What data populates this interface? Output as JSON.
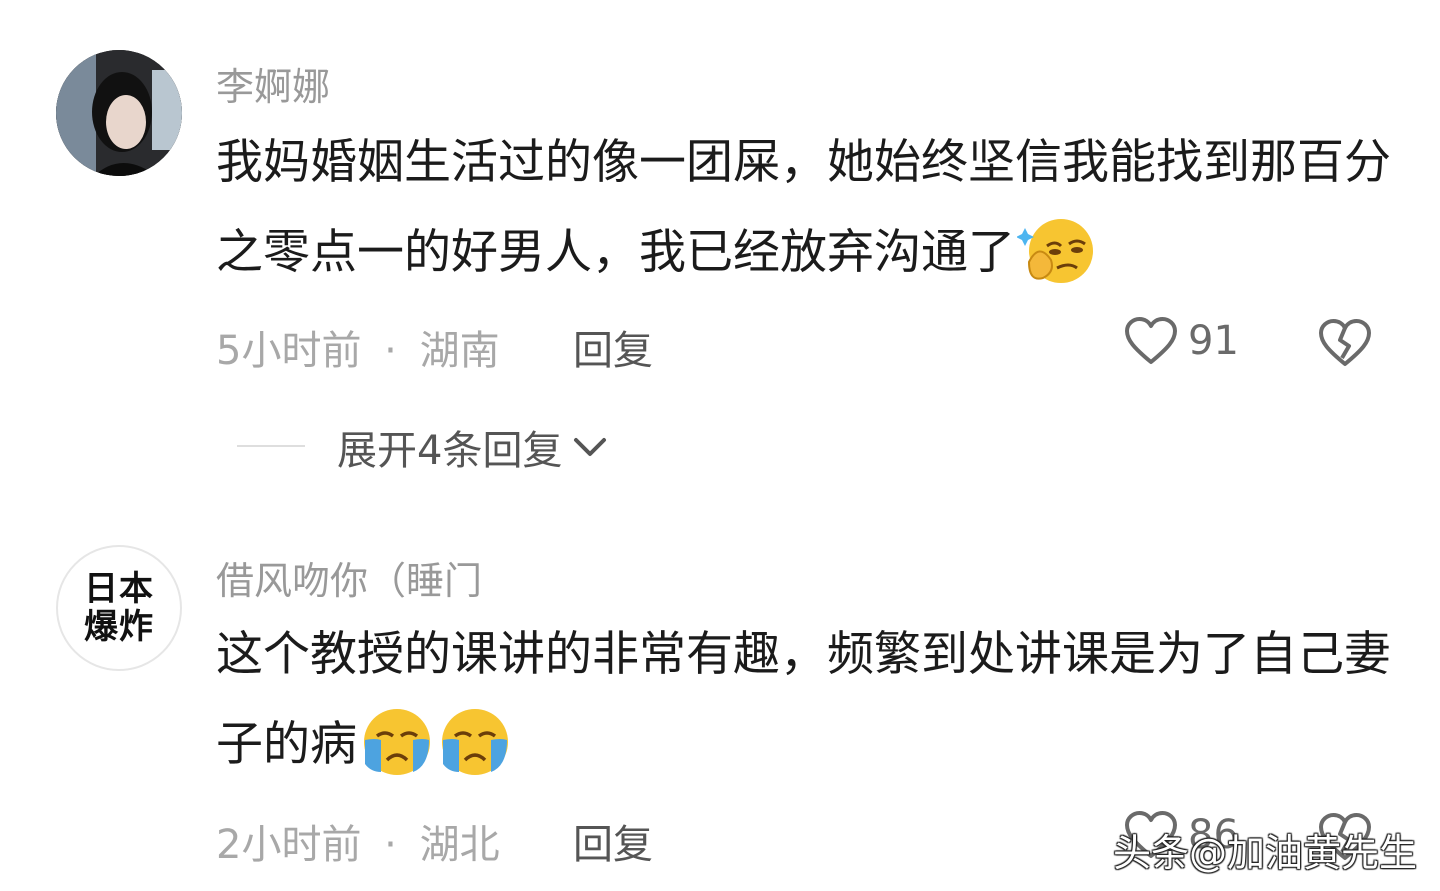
{
  "comments": [
    {
      "username": "李婀娜",
      "avatar_icon": "user-photo-avatar",
      "text": "我妈婚姻生活过的像一团屎，她始终坚信我能找到那百分之零点一的好男人，我已经放弃沟通了",
      "emoji": [
        "smug-face-emoji"
      ],
      "time": "5小时前",
      "sep": "·",
      "location": "湖南",
      "reply_label": "回复",
      "likes": "91",
      "expand_label": "展开4条回复"
    },
    {
      "username": "借风吻你（睡门",
      "avatar_text": "日本\n爆炸",
      "text": "这个教授的课讲的非常有趣，频繁到处讲课是为了自己妻子的病",
      "emoji": [
        "crying-face-emoji",
        "crying-face-emoji"
      ],
      "time": "2小时前",
      "sep": "·",
      "location": "湖北",
      "reply_label": "回复",
      "likes": "86"
    }
  ],
  "watermark": "头条@加油黄先生",
  "colors": {
    "secondary_text": "#999999",
    "primary_text": "#1b1b1b",
    "emoji_yellow": "#f7c531",
    "tears_blue": "#4da3e0"
  }
}
